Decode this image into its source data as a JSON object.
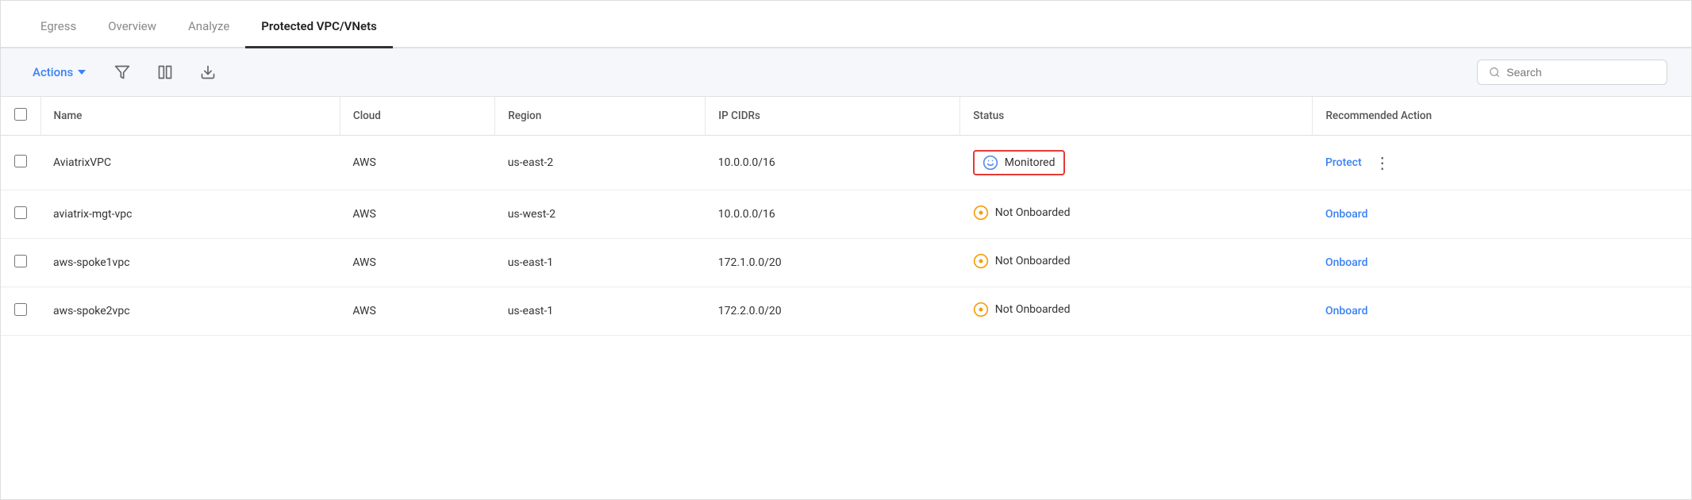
{
  "tabs": [
    {
      "id": "egress",
      "label": "Egress",
      "active": false
    },
    {
      "id": "overview",
      "label": "Overview",
      "active": false
    },
    {
      "id": "analyze",
      "label": "Analyze",
      "active": false
    },
    {
      "id": "protected-vpc",
      "label": "Protected VPC/VNets",
      "active": true
    }
  ],
  "toolbar": {
    "actions_label": "Actions",
    "search_placeholder": "Search"
  },
  "table": {
    "columns": [
      "Name",
      "Cloud",
      "Region",
      "IP CIDRs",
      "Status",
      "Recommended Action"
    ],
    "rows": [
      {
        "name": "AviatrixVPC",
        "cloud": "AWS",
        "region": "us-east-2",
        "ip_cidrs": "10.0.0.0/16",
        "status": "Monitored",
        "status_type": "monitored",
        "action": "Protect",
        "has_more": true
      },
      {
        "name": "aviatrix-mgt-vpc",
        "cloud": "AWS",
        "region": "us-west-2",
        "ip_cidrs": "10.0.0.0/16",
        "status": "Not Onboarded",
        "status_type": "not-onboarded",
        "action": "Onboard",
        "has_more": false
      },
      {
        "name": "aws-spoke1vpc",
        "cloud": "AWS",
        "region": "us-east-1",
        "ip_cidrs": "172.1.0.0/20",
        "status": "Not Onboarded",
        "status_type": "not-onboarded",
        "action": "Onboard",
        "has_more": false
      },
      {
        "name": "aws-spoke2vpc",
        "cloud": "AWS",
        "region": "us-east-1",
        "ip_cidrs": "172.2.0.0/20",
        "status": "Not Onboarded",
        "status_type": "not-onboarded",
        "action": "Onboard",
        "has_more": false
      }
    ]
  }
}
